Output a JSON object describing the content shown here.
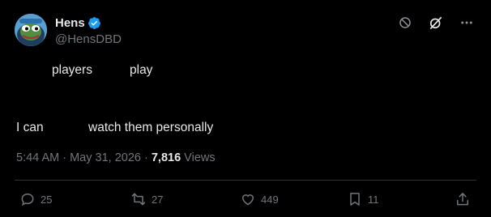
{
  "tweet": {
    "author": {
      "display_name": "Hens",
      "handle": "@HensDBD",
      "verified": true,
      "verified_color": "#1d9bf0",
      "avatar_icon": "pepe-avatar-icon"
    },
    "header_actions": [
      {
        "icon": "block-icon"
      },
      {
        "icon": "grok-icon"
      },
      {
        "icon": "more-icon"
      }
    ],
    "body": {
      "line1_words": [
        "players",
        "play"
      ],
      "line2_words": [
        "I can",
        "watch them personally"
      ]
    },
    "meta": {
      "time": "5:44 AM",
      "separator1": " · ",
      "date": "May 31, 2026",
      "separator2": " · ",
      "views_count": "7,816",
      "views_label": " Views"
    },
    "actions": {
      "reply": {
        "icon": "reply-icon",
        "count": "25"
      },
      "retweet": {
        "icon": "retweet-icon",
        "count": "27"
      },
      "like": {
        "icon": "heart-icon",
        "count": "449"
      },
      "bookmark": {
        "icon": "bookmark-icon",
        "count": "11"
      },
      "share": {
        "icon": "share-icon"
      }
    },
    "colors": {
      "background": "#000000",
      "text": "#e7e9ea",
      "secondary": "#71767b",
      "divider": "#2f3336"
    }
  }
}
